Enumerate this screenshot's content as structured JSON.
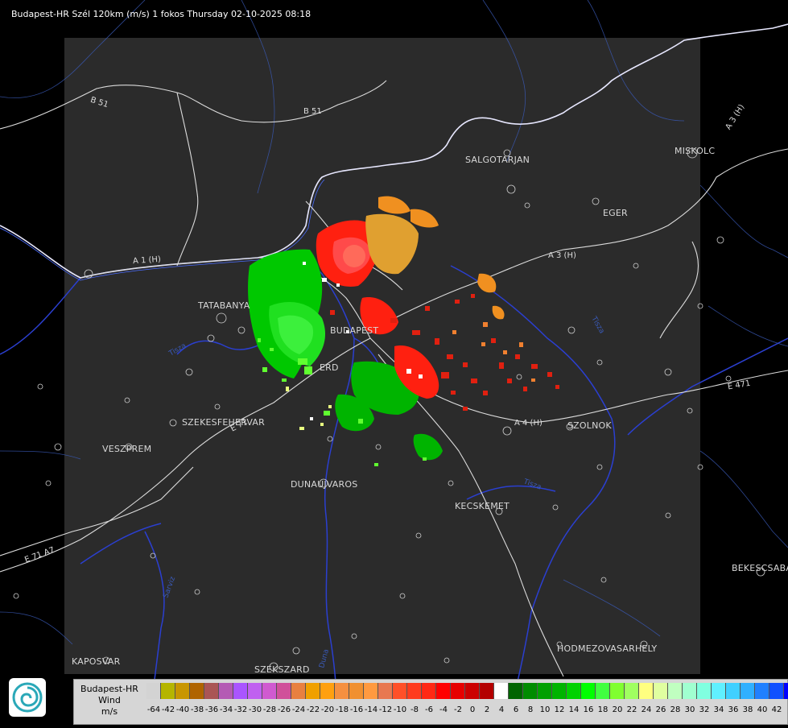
{
  "header": {
    "title": "Budapest-HR Szél 120km (m/s) 1 fokos Thursday 02-10-2025 08:18"
  },
  "cities": [
    {
      "name": "SALGOTARJAN"
    },
    {
      "name": "MISKOLC"
    },
    {
      "name": "EGER"
    },
    {
      "name": "TATABANYA"
    },
    {
      "name": "BUDAPEST"
    },
    {
      "name": "ERD"
    },
    {
      "name": "SZEKESFEHERVAR"
    },
    {
      "name": "VESZPREM"
    },
    {
      "name": "DUNAUJVAROS"
    },
    {
      "name": "KECSKEMET"
    },
    {
      "name": "SZOLNOK"
    },
    {
      "name": "BEKESCSABA"
    },
    {
      "name": "HODMEZOVASARHELY"
    },
    {
      "name": "KAPOSVAR"
    },
    {
      "name": "SZEKSZARD"
    }
  ],
  "roads": [
    {
      "label": "B 51"
    },
    {
      "label": "B 51"
    },
    {
      "label": "A 1 (H)"
    },
    {
      "label": "A 3 (H)"
    },
    {
      "label": "A 3 (H)"
    },
    {
      "label": "A 4 (H)"
    },
    {
      "label": "E 71"
    },
    {
      "label": "E 71 A7"
    },
    {
      "label": "E 471"
    }
  ],
  "logo": {
    "icon": "omsz-logo-icon"
  },
  "legend": {
    "station": "Budapest-HR",
    "quantity": "Wind",
    "unit": "m/s",
    "colors": [
      "#d3d3d3",
      "#b5b500",
      "#c89600",
      "#b06400",
      "#aa5555",
      "#b45ab4",
      "#aa55ff",
      "#c060f0",
      "#d05ad0",
      "#d0509a",
      "#e88040",
      "#f0a000",
      "#ffa010",
      "#f59040",
      "#f09030",
      "#ff9a40",
      "#e87850",
      "#ff5028",
      "#ff3c1e",
      "#ff2814",
      "#ff0000",
      "#e60000",
      "#cc0000",
      "#b40000",
      "#ffffff",
      "#006400",
      "#008c00",
      "#00a000",
      "#00b400",
      "#00d200",
      "#00ff00",
      "#40ff40",
      "#80ff30",
      "#a0ff60",
      "#ffff80",
      "#e0ffa0",
      "#c0ffc0",
      "#a0ffd0",
      "#80ffe0",
      "#60f0ff",
      "#40d0ff",
      "#30b0ff",
      "#2080ff",
      "#1050ff",
      "#0000ff"
    ],
    "ticks": [
      "-64",
      "-42",
      "-40",
      "-38",
      "-36",
      "-34",
      "-32",
      "-30",
      "-28",
      "-26",
      "-24",
      "-22",
      "-20",
      "-18",
      "-16",
      "-14",
      "-12",
      "-10",
      "-8",
      "-6",
      "-4",
      "-2",
      "0",
      "2",
      "4",
      "6",
      "8",
      "10",
      "12",
      "14",
      "16",
      "18",
      "20",
      "22",
      "24",
      "26",
      "28",
      "30",
      "32",
      "34",
      "36",
      "38",
      "40",
      "42"
    ]
  }
}
